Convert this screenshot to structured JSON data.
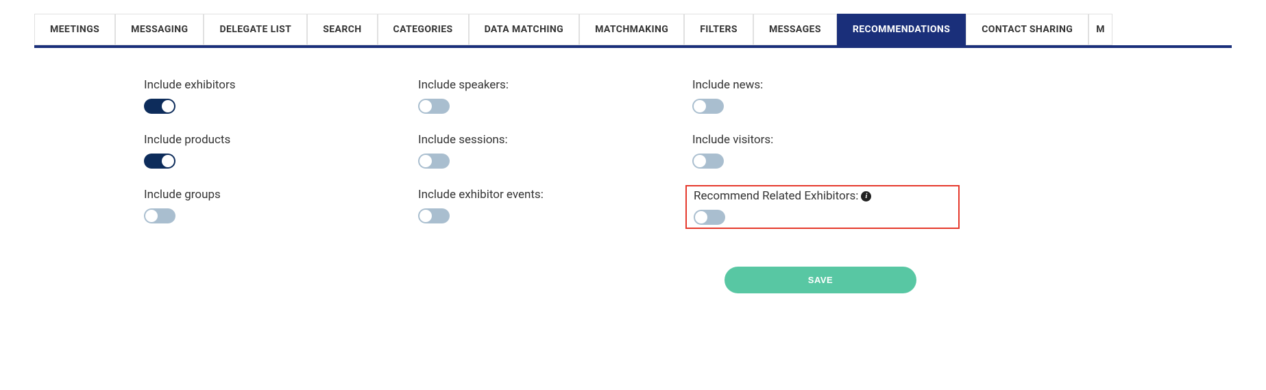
{
  "tabs": [
    {
      "label": "MEETINGS",
      "active": false
    },
    {
      "label": "MESSAGING",
      "active": false
    },
    {
      "label": "DELEGATE LIST",
      "active": false
    },
    {
      "label": "SEARCH",
      "active": false
    },
    {
      "label": "CATEGORIES",
      "active": false
    },
    {
      "label": "DATA MATCHING",
      "active": false
    },
    {
      "label": "MATCHMAKING",
      "active": false
    },
    {
      "label": "FILTERS",
      "active": false
    },
    {
      "label": "MESSAGES",
      "active": false
    },
    {
      "label": "RECOMMENDATIONS",
      "active": true
    },
    {
      "label": "CONTACT SHARING",
      "active": false
    }
  ],
  "overflow_tab_letter": "M",
  "settings": {
    "exhibitors": {
      "label": "Include exhibitors",
      "on": true,
      "info": false,
      "highlighted": false
    },
    "speakers": {
      "label": "Include speakers:",
      "on": false,
      "info": false,
      "highlighted": false
    },
    "news": {
      "label": "Include news:",
      "on": false,
      "info": false,
      "highlighted": false
    },
    "products": {
      "label": "Include products",
      "on": true,
      "info": false,
      "highlighted": false
    },
    "sessions": {
      "label": "Include sessions:",
      "on": false,
      "info": false,
      "highlighted": false
    },
    "visitors": {
      "label": "Include visitors:",
      "on": false,
      "info": false,
      "highlighted": false
    },
    "groups": {
      "label": "Include groups",
      "on": false,
      "info": false,
      "highlighted": false
    },
    "exhibitor_events": {
      "label": "Include exhibitor events:",
      "on": false,
      "info": false,
      "highlighted": false
    },
    "related": {
      "label": "Recommend Related Exhibitors:",
      "on": false,
      "info": true,
      "highlighted": true
    }
  },
  "buttons": {
    "save": "SAVE"
  }
}
